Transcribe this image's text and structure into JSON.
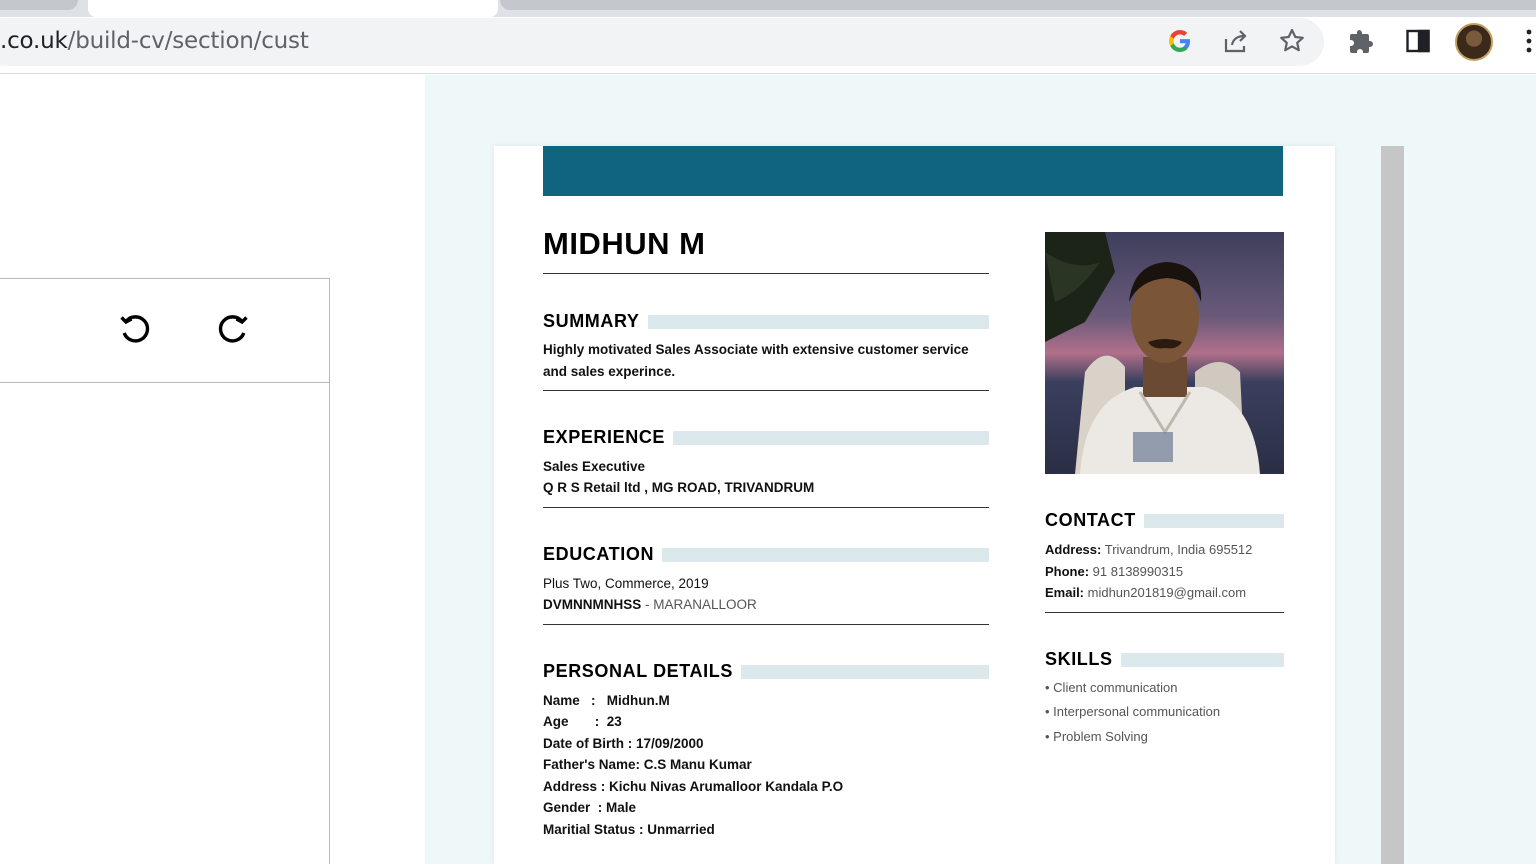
{
  "browser": {
    "url_host": ".co.uk",
    "url_path": "/build-cv/section/cust",
    "icons": [
      "google-icon",
      "share-icon",
      "bookmark-star-icon",
      "extensions-icon",
      "side-panel-icon",
      "profile-avatar",
      "menu-dots-icon"
    ]
  },
  "editor": {
    "undo_icon": "undo-icon",
    "redo_icon": "redo-icon"
  },
  "colors": {
    "banner": "#116480",
    "section_bar": "#dbe8ec",
    "preview_bg": "#eff8f9"
  },
  "cv": {
    "name": "MIDHUN M",
    "summary": {
      "title": "SUMMARY",
      "line1": "Highly motivated Sales Associate with extensive customer service",
      "line2": "and sales experince."
    },
    "experience": {
      "title": "EXPERIENCE",
      "role": "Sales Executive",
      "company": "Q R S Retail ltd , MG ROAD, TRIVANDRUM"
    },
    "education": {
      "title": "EDUCATION",
      "degree": "Plus Two, Commerce, 2019",
      "school": "DVMNNMNHSS",
      "location": " - MARANALLOOR"
    },
    "personal": {
      "title": "PERSONAL DETAILS",
      "lines": [
        "Name   :   Midhun.M",
        "Age       :  23",
        "Date of Birth : 17/09/2000",
        "Father's Name: C.S Manu Kumar",
        "Address : Kichu Nivas Arumalloor Kandala P.O",
        "Gender  : Male",
        "Maritial Status : Unmarried"
      ]
    },
    "contact": {
      "title": "CONTACT",
      "address_label": "Address:",
      "address": " Trivandrum, India 695512",
      "phone_label": "Phone:",
      "phone": " 91 8138990315",
      "email_label": "Email:",
      "email": " midhun201819@gmail.com"
    },
    "skills": {
      "title": "SKILLS",
      "items": [
        "• Client communication",
        "• Interpersonal communication",
        "• Problem Solving"
      ]
    }
  }
}
